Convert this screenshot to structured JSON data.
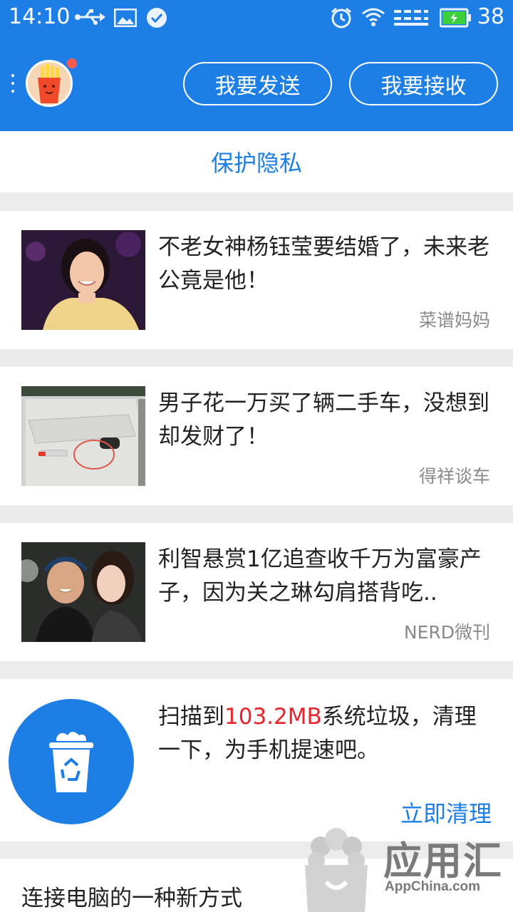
{
  "status_bar": {
    "time": "14:10",
    "battery_level": "38",
    "left_icons": [
      "usb-icon",
      "image-icon",
      "check-circle-icon"
    ],
    "right_icons": [
      "alarm-icon",
      "wifi-icon",
      "signal-icon",
      "battery-icon"
    ]
  },
  "header": {
    "send_button": "我要发送",
    "receive_button": "我要接收",
    "accent_color": "#1d7ee6",
    "has_notification_dot": true
  },
  "privacy_banner": {
    "label": "保护隐私"
  },
  "news": [
    {
      "title": "不老女神杨钰莹要结婚了，未来老公竟是他！",
      "source": "菜谱妈妈",
      "thumbnail": "woman-portrait-image"
    },
    {
      "title": "男子花一万买了辆二手车，没想到却发财了！",
      "source": "得祥谈车",
      "thumbnail": "car-door-image"
    },
    {
      "title": "利智悬赏1亿追查收千万为富豪产子，因为关之琳勾肩搭背吃..",
      "source": "NERD微刊",
      "thumbnail": "couple-photo-image"
    }
  ],
  "cleanup": {
    "text_prefix": "扫描到",
    "highlight": "103.2MB",
    "text_suffix": "系统垃圾，清理一下，为手机提速吧。",
    "action": "立即清理",
    "highlight_color": "#e8232b"
  },
  "bottom_card": {
    "title": "连接电脑的一种新方式"
  },
  "watermark": {
    "title": "应用汇",
    "subtitle": "AppChina.com"
  }
}
